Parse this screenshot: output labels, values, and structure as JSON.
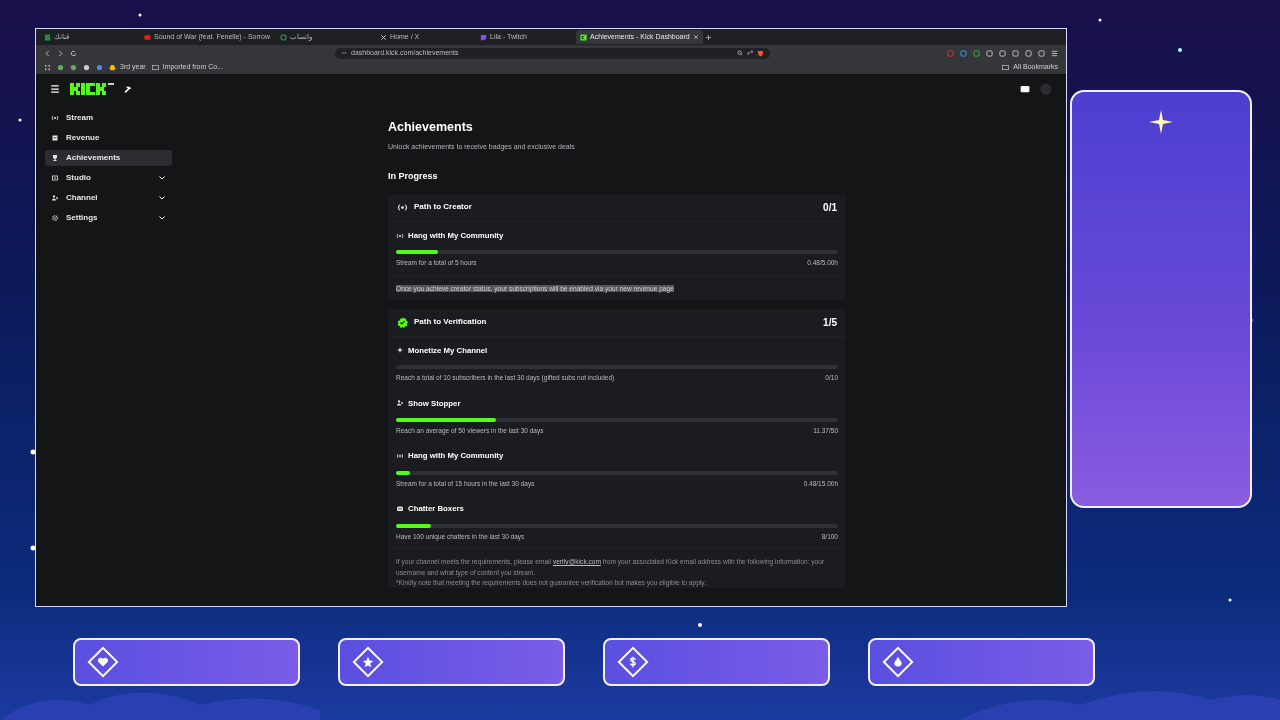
{
  "browser": {
    "tabs": [
      {
        "title": "قناتك",
        "selected": false
      },
      {
        "title": "Sound of War (feat. Fenelle) - Sorrow",
        "selected": false
      },
      {
        "title": "واتساب",
        "selected": false
      },
      {
        "title": "Home / X",
        "selected": false
      },
      {
        "title": "Lila - Twitch",
        "selected": false
      },
      {
        "title": "Achievements - Kick Dashboard",
        "selected": true
      }
    ],
    "url": "dashboard.kick.com/achievements",
    "bookmarks": [
      "3rd year",
      "Imported from Co..."
    ],
    "all_bookmarks": "All Bookmarks"
  },
  "sidebar": {
    "items": [
      {
        "label": "Stream",
        "selected": false,
        "expandable": false
      },
      {
        "label": "Revenue",
        "selected": false,
        "expandable": false
      },
      {
        "label": "Achievements",
        "selected": true,
        "expandable": false
      },
      {
        "label": "Studio",
        "selected": false,
        "expandable": true
      },
      {
        "label": "Channel",
        "selected": false,
        "expandable": true
      },
      {
        "label": "Settings",
        "selected": false,
        "expandable": true
      }
    ]
  },
  "page": {
    "title": "Achievements",
    "subtitle": "Unlock achievements to receive badges and exclusive deals",
    "section": "In Progress",
    "groups": [
      {
        "title": "Path to Creator",
        "kind": "creator",
        "count": "0/1",
        "tasks": [
          {
            "title": "Hang with My Community",
            "kind": "streaming",
            "description": "Stream for a total of 5 hours",
            "progress": "0.48/5.00h",
            "level": 0.096
          }
        ],
        "note": {
          "text": "Once you achieve creator status, your subscriptions will be enabled via your new revenue page",
          "highlighted": true
        }
      },
      {
        "title": "Path to Verification",
        "kind": "verification",
        "count": "1/5",
        "tasks": [
          {
            "title": "Monetize My Channel",
            "kind": "subscribers",
            "description": "Reach a total of 10 subscribers in the last 30 days (gifted subs not included)",
            "progress": "0/10",
            "level": 0
          },
          {
            "title": "Show Stopper",
            "kind": "viewers",
            "description": "Reach an average of 50 viewers in the last 30 days",
            "progress": "11.37/50",
            "level": 0.227
          },
          {
            "title": "Hang with My Community",
            "kind": "streaming",
            "description": "Stream for a total of 15 hours in the last 30 days",
            "progress": "0.48/15.00h",
            "level": 0.032
          },
          {
            "title": "Chatter Boxers",
            "kind": "chatters",
            "description": "Have 100 unique chatters in the last 30 days",
            "progress": "8/100",
            "level": 0.08
          }
        ],
        "footer": {
          "before": "If your channel meets the requirements, please email",
          "link": "verify@kick.com",
          "after": "from your associated Kick email address with the following information: your username and what type of content you stream.",
          "disclaimer": "*Kindly note that meeting the requirements does not guarantee verification but makes you eligible to apply."
        }
      }
    ]
  }
}
